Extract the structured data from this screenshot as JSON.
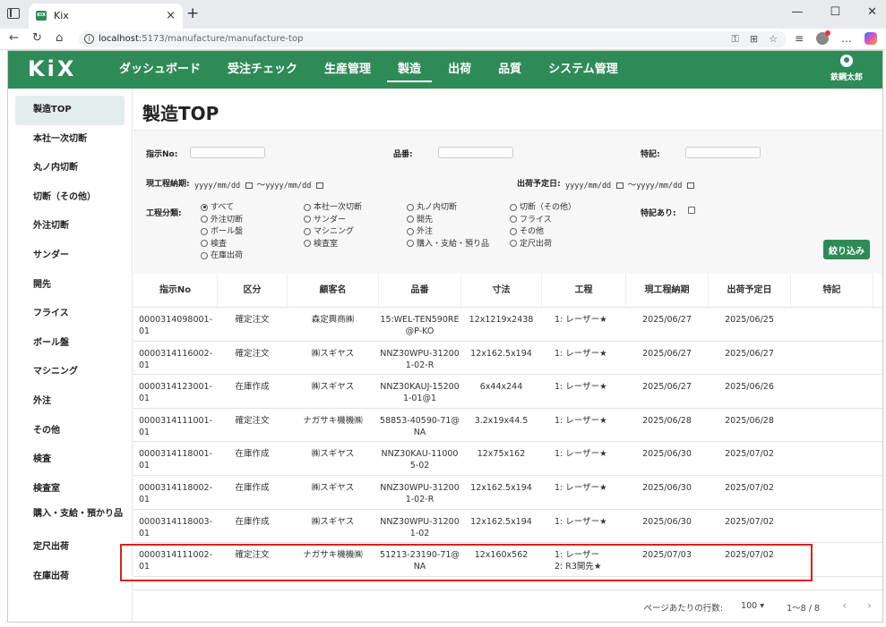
{
  "browser": {
    "tab_title": "Kix",
    "tab_favicon": "KIX",
    "url_host": "localhost",
    "url_path": ":5173/manufacture/manufacture-top"
  },
  "app": {
    "logo": "KiX",
    "brand_color": "#2e8b57",
    "nav": [
      "ダッシュボード",
      "受注チェック",
      "生産管理",
      "製造",
      "出荷",
      "品質",
      "システム管理"
    ],
    "active_nav": "製造",
    "user_name": "鉄鋼太郎"
  },
  "sidebar": {
    "items": [
      "製造TOP",
      "本社一次切断",
      "丸ノ内切断",
      "切断（その他）",
      "外注切断",
      "サンダー",
      "開先",
      "フライス",
      "ボール盤",
      "マシニング",
      "外注",
      "その他",
      "検査",
      "検査室",
      "購入・支給・預かり品",
      "定尺出荷",
      "在庫出荷"
    ]
  },
  "page": {
    "title": "製造TOP"
  },
  "filters": {
    "order_no_label": "指示No:",
    "part_no_label": "品番:",
    "note_label": "特記:",
    "due_label": "現工程納期:",
    "ship_label": "出荷予定日:",
    "date_placeholder": "yyyy/mm/dd",
    "tilde": "〜",
    "process_label": "工程分類:",
    "has_note_label": "特記あり:",
    "process_options_col1": [
      "すべて",
      "外注切断",
      "ボール盤",
      "検査",
      "在庫出荷"
    ],
    "process_options_col2": [
      "本社一次切断",
      "サンダー",
      "マシニング",
      "検査室"
    ],
    "process_options_col3": [
      "丸ノ内切断",
      "開先",
      "外注",
      "購入・支給・預り品"
    ],
    "process_options_col4": [
      "切断（その他）",
      "フライス",
      "その他",
      "定尺出荷"
    ],
    "selected_process": "すべて",
    "filter_button": "絞り込み"
  },
  "table": {
    "headers": [
      "指示No",
      "区分",
      "顧客名",
      "品番",
      "寸法",
      "工程",
      "現工程納期",
      "出荷予定日",
      "特記"
    ],
    "rows": [
      {
        "no": "0000314098001-01",
        "kubun": "確定注文",
        "customer": "森定興商㈱",
        "part": "15:WEL-TEN590RE@P-KO",
        "size": "12x1219x2438",
        "process": "1: レーザー★",
        "due": "2025/06/27",
        "ship": "2025/06/25",
        "note": ""
      },
      {
        "no": "0000314116002-01",
        "kubun": "確定注文",
        "customer": "㈱スギヤス",
        "part": "NNZ30WPU-312001-02-R",
        "size": "12x162.5x194",
        "process": "1: レーザー★",
        "due": "2025/06/27",
        "ship": "2025/06/27",
        "note": ""
      },
      {
        "no": "0000314123001-01",
        "kubun": "在庫作成",
        "customer": "㈱スギヤス",
        "part": "NNZ30KAUJ-152001-01@1",
        "size": "6x44x244",
        "process": "1: レーザー★",
        "due": "2025/06/27",
        "ship": "2025/06/26",
        "note": ""
      },
      {
        "no": "0000314111001-01",
        "kubun": "確定注文",
        "customer": "ナガサキ機機㈱",
        "part": "58853-40590-71@NA",
        "size": "3.2x19x44.5",
        "process": "1: レーザー★",
        "due": "2025/06/28",
        "ship": "2025/06/28",
        "note": ""
      },
      {
        "no": "0000314118001-01",
        "kubun": "在庫作成",
        "customer": "㈱スギヤス",
        "part": "NNZ30KAU-110005-02",
        "size": "12x75x162",
        "process": "1: レーザー★",
        "due": "2025/06/30",
        "ship": "2025/07/02",
        "note": ""
      },
      {
        "no": "0000314118002-01",
        "kubun": "在庫作成",
        "customer": "㈱スギヤス",
        "part": "NNZ30WPU-312001-02-R",
        "size": "12x162.5x194",
        "process": "1: レーザー★",
        "due": "2025/06/30",
        "ship": "2025/07/02",
        "note": ""
      },
      {
        "no": "0000314118003-01",
        "kubun": "在庫作成",
        "customer": "㈱スギヤス",
        "part": "NNZ30WPU-312001-02",
        "size": "12x162.5x194",
        "process": "1: レーザー★",
        "due": "2025/06/30",
        "ship": "2025/07/02",
        "note": ""
      },
      {
        "no": "0000314111002-01",
        "kubun": "確定注文",
        "customer": "ナガサキ機機㈱",
        "part": "51213-23190-71@NA",
        "size": "12x160x562",
        "process": "1: レーザー\n2: R3開先★",
        "due": "2025/07/03",
        "ship": "2025/07/02",
        "note": ""
      }
    ]
  },
  "pager": {
    "rows_label": "ページあたりの行数:",
    "rows_value": "100",
    "range": "1〜8 / 8"
  },
  "highlight_color": "#d9221c"
}
